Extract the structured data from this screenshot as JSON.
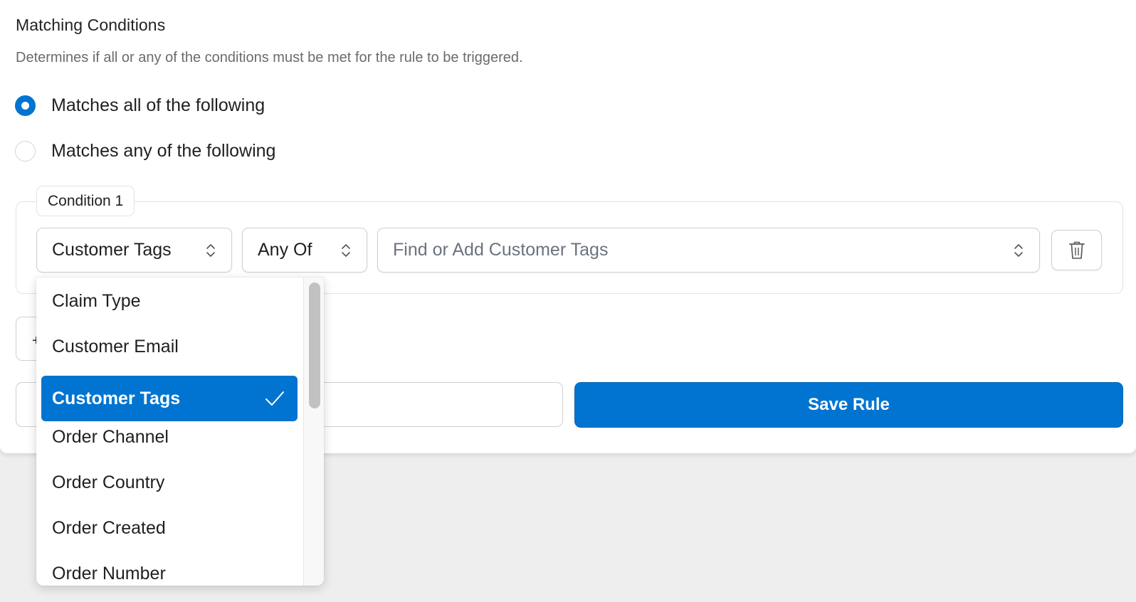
{
  "section": {
    "title": "Matching Conditions",
    "description": "Determines if all or any of the conditions must be met for the rule to be triggered."
  },
  "match_mode": {
    "options": [
      {
        "label": "Matches all of the following",
        "checked": true
      },
      {
        "label": "Matches any of the following",
        "checked": false
      }
    ]
  },
  "condition": {
    "legend": "Condition 1",
    "field_select": {
      "value": "Customer Tags",
      "icon": "chevron-up-down-icon"
    },
    "operator_select": {
      "value": "Any Of",
      "icon": "chevron-up-down-icon"
    },
    "value_input": {
      "placeholder": "Find or Add Customer Tags",
      "value": "",
      "icon": "chevron-up-down-icon"
    },
    "delete_icon": "trash-icon"
  },
  "add_condition": {
    "icon": "plus-icon"
  },
  "actions": {
    "cancel_label": "",
    "save_label": "Save Rule"
  },
  "dropdown": {
    "selected": "Customer Tags",
    "items": [
      {
        "label": "Claim Type"
      },
      {
        "label": "Customer Email"
      },
      {
        "label": "Customer Tags"
      },
      {
        "label": "Order Channel"
      },
      {
        "label": "Order Country"
      },
      {
        "label": "Order Created"
      },
      {
        "label": "Order Number"
      }
    ]
  },
  "colors": {
    "accent": "#0074d0",
    "background": "#eeeeee",
    "border": "#cfcfcf",
    "muted_text": "#6b6b6b"
  }
}
